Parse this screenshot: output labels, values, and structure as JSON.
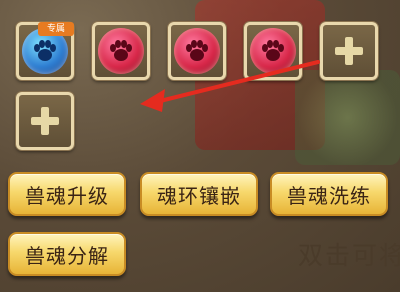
{
  "slots": [
    {
      "type": "blue-paw",
      "icon": "paw-icon",
      "tag": "专属"
    },
    {
      "type": "red-paw",
      "icon": "paw-icon"
    },
    {
      "type": "red-paw",
      "icon": "paw-icon"
    },
    {
      "type": "red-paw",
      "icon": "paw-icon"
    },
    {
      "type": "empty",
      "icon": "plus-icon"
    },
    {
      "type": "empty",
      "icon": "plus-icon"
    }
  ],
  "buttons": {
    "upgrade": "兽魂升级",
    "inlay": "魂环镶嵌",
    "refine": "兽魂洗练",
    "decompose": "兽魂分解"
  },
  "background_hint": "双击可将",
  "colors": {
    "button_gold": "#f7d86c",
    "arrow_red": "#e52b1f"
  }
}
